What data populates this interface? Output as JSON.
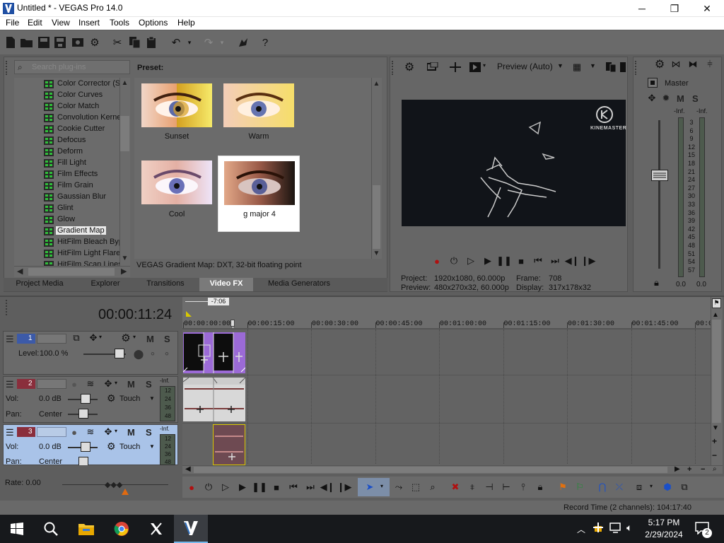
{
  "window": {
    "title": "Untitled * - VEGAS Pro 14.0",
    "minimize": "─",
    "maximize": "❐",
    "close": "✕"
  },
  "menu": [
    "File",
    "Edit",
    "View",
    "Insert",
    "Tools",
    "Options",
    "Help"
  ],
  "plugins": {
    "search_placeholder": "Search plug-ins",
    "items": [
      "Color Corrector (S",
      "Color Curves",
      "Color Match",
      "Convolution Kerne",
      "Cookie Cutter",
      "Defocus",
      "Deform",
      "Fill Light",
      "Film Effects",
      "Film Grain",
      "Gaussian Blur",
      "Glint",
      "Glow",
      "Gradient Map",
      "HitFilm Bleach Byp",
      "HitFilm Light Flares",
      "HitFilm Scan Lines"
    ],
    "selected": "Gradient Map"
  },
  "presets": {
    "heading": "Preset:",
    "items": [
      {
        "name": "Sunset"
      },
      {
        "name": "Warm"
      },
      {
        "name": "Cool"
      },
      {
        "name": "g major 4"
      }
    ],
    "selected": "g major 4",
    "description": "VEGAS Gradient Map: DXT, 32-bit floating point"
  },
  "tabs": [
    "Project Media",
    "Explorer",
    "Transitions",
    "Video FX",
    "Media Generators"
  ],
  "active_tab": "Video FX",
  "preview": {
    "mode": "Preview (Auto)",
    "watermark": "KINEMASTER",
    "project_label": "Project:",
    "project_value": "1920x1080, 60.000p",
    "preview_label": "Preview:",
    "preview_value": "480x270x32, 60.000p",
    "frame_label": "Frame:",
    "frame_value": "708",
    "display_label": "Display:",
    "display_value": "317x178x32"
  },
  "master": {
    "label": "Master",
    "inf_left": "-Inf.",
    "inf_right": "-Inf.",
    "scale": [
      "3",
      "6",
      "9",
      "12",
      "15",
      "18",
      "21",
      "24",
      "27",
      "30",
      "33",
      "36",
      "39",
      "42",
      "45",
      "48",
      "51",
      "54",
      "57"
    ],
    "bottom_left": "0.0",
    "bottom_right": "0.0"
  },
  "timeline": {
    "timecode": "00:00:11:24",
    "marker": "-7:06",
    "ruler": [
      "00:00:00:00",
      "00:00:15:00",
      "00:00:30:00",
      "00:00:45:00",
      "00:01:00:00",
      "00:01:15:00",
      "00:01:30:00",
      "00:01:45:00",
      "00:0"
    ],
    "tracks": [
      {
        "number": "1",
        "type": "video",
        "level_label": "Level:",
        "level_value": "100.0 %"
      },
      {
        "number": "2",
        "type": "audio",
        "vol_label": "Vol:",
        "vol_value": "0.0 dB",
        "pan_label": "Pan:",
        "pan_value": "Center",
        "mode": "Touch",
        "meter_top": "-Inf.",
        "meter_scale": [
          "12",
          "24",
          "36",
          "48"
        ]
      },
      {
        "number": "3",
        "type": "audio",
        "vol_label": "Vol:",
        "vol_value": "0.0 dB",
        "pan_label": "Pan:",
        "pan_value": "Center",
        "mode": "Touch",
        "meter_top": "-Inf.",
        "meter_scale": [
          "12",
          "24",
          "36",
          "48"
        ],
        "selected": true
      }
    ],
    "mute": "M",
    "solo": "S",
    "rate_label": "Rate: 0.00",
    "record_time": "Record Time (2 channels): 104:17:40"
  },
  "taskbar": {
    "time": "5:17 PM",
    "date": "2/29/2024",
    "notifications": "2"
  },
  "colors": {
    "accent_blue": "#0a64d8",
    "track_purple": "#9b6ad6",
    "audio_clip": "#6e4a52",
    "selected_track": "#a9c3e8"
  }
}
